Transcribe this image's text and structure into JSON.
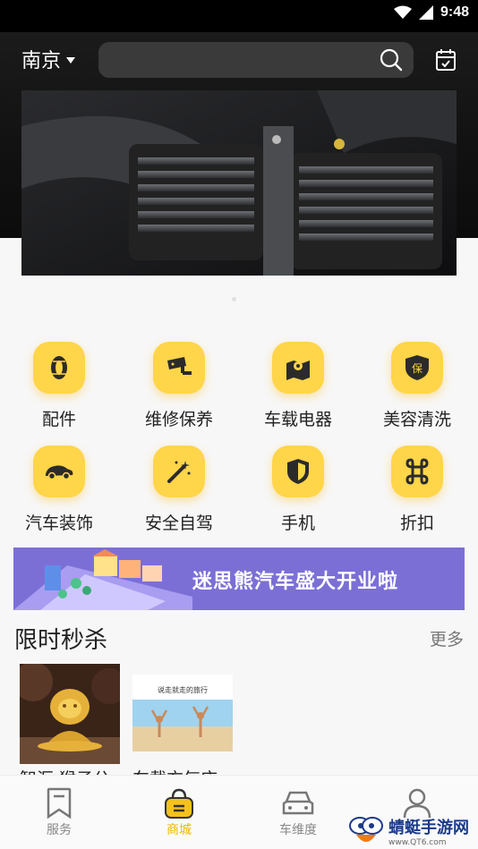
{
  "status_bar": {
    "time": "9:48"
  },
  "header": {
    "city": "南京",
    "search_placeholder": ""
  },
  "categories": [
    {
      "label": "配件",
      "icon": "tire-icon"
    },
    {
      "label": "维修保养",
      "icon": "camera-icon"
    },
    {
      "label": "车载电器",
      "icon": "map-pin-icon"
    },
    {
      "label": "美容清洗",
      "icon": "shield-bao-icon"
    },
    {
      "label": "汽车装饰",
      "icon": "car-icon"
    },
    {
      "label": "安全自驾",
      "icon": "magic-wand-icon"
    },
    {
      "label": "手机",
      "icon": "shield-icon"
    },
    {
      "label": "折扣",
      "icon": "command-icon"
    }
  ],
  "promo": {
    "text": "迷思熊汽车盛大开业啦"
  },
  "flash_sale": {
    "title": "限时秒杀",
    "more": "更多",
    "products": [
      {
        "name": "智汇 猴子公"
      },
      {
        "name": "车载充气床",
        "image_caption": "说走就走的旅行"
      }
    ]
  },
  "bottom_nav": [
    {
      "label": "服务",
      "active": false
    },
    {
      "label": "商城",
      "active": true
    },
    {
      "label": "车维度",
      "active": false
    },
    {
      "label": "",
      "active": false
    }
  ],
  "watermark": {
    "title": "蜻蜓手游网",
    "url": "www.QT6.com"
  },
  "colors": {
    "accent": "#ffd54a",
    "active_nav": "#f0b800",
    "promo_bg": "#7b6fd6"
  }
}
